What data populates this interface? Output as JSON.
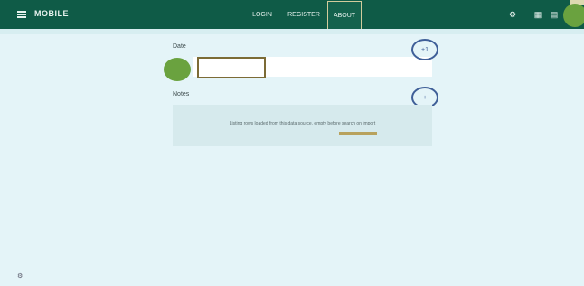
{
  "app": {
    "title": "MOBILE"
  },
  "nav": {
    "items": [
      "LOGIN",
      "REGISTER",
      "ABOUT"
    ],
    "active_index": 2
  },
  "topbar_icons": [
    "settings-icon",
    "grid-icon",
    "document-icon"
  ],
  "form": {
    "label_a": "Date",
    "label_b": "Notes",
    "input_value": "",
    "circle_a_label": "+1",
    "circle_b_label": "+",
    "card_text": "Listing rows loaded from this data source, empty before search on import",
    "card_button_label": ""
  },
  "colors": {
    "topbar": "#0f5b47",
    "background": "#e4f4f8",
    "accent_green": "#6aa23f",
    "focus_border": "#7c6b36",
    "circle_outline": "#3f5f98"
  }
}
